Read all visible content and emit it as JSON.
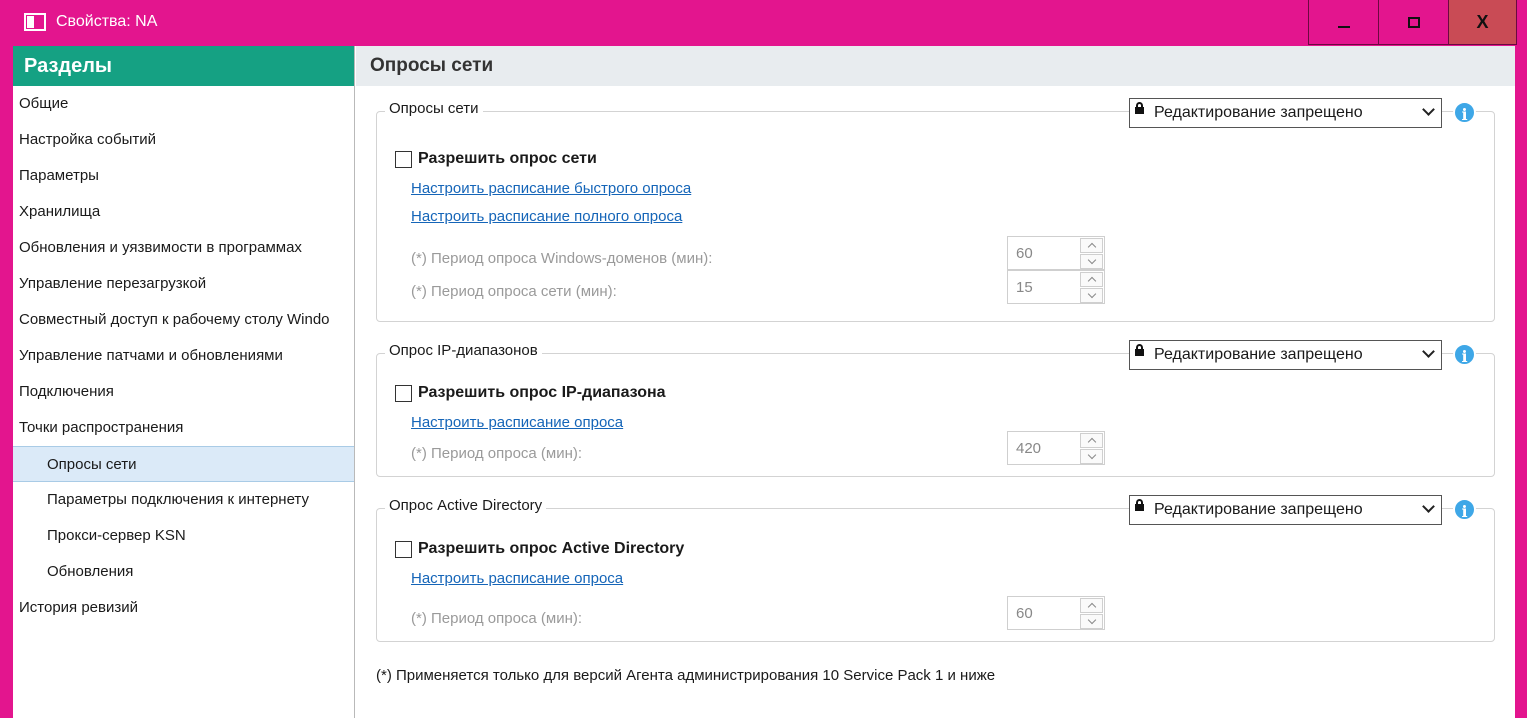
{
  "window": {
    "title": "Свойства: NA",
    "minimize_icon": "minimize-icon",
    "maximize_icon": "maximize-icon",
    "close_label": "X"
  },
  "sidebar": {
    "header": "Разделы",
    "items": [
      {
        "label": "Общие",
        "level": 0
      },
      {
        "label": "Настройка событий",
        "level": 0
      },
      {
        "label": "Параметры",
        "level": 0
      },
      {
        "label": "Хранилища",
        "level": 0
      },
      {
        "label": "Обновления и уязвимости в программах",
        "level": 0
      },
      {
        "label": "Управление перезагрузкой",
        "level": 0
      },
      {
        "label": "Совместный доступ к рабочему столу Windo",
        "level": 0
      },
      {
        "label": "Управление патчами и обновлениями",
        "level": 0
      },
      {
        "label": "Подключения",
        "level": 0
      },
      {
        "label": "Точки распространения",
        "level": 0
      },
      {
        "label": "Опросы сети",
        "level": 1,
        "selected": true
      },
      {
        "label": "Параметры подключения к интернету",
        "level": 1
      },
      {
        "label": "Прокси-сервер KSN",
        "level": 1
      },
      {
        "label": "Обновления",
        "level": 1
      },
      {
        "label": "История ревизий",
        "level": 0
      }
    ]
  },
  "main": {
    "title": "Опросы сети",
    "groups": [
      {
        "title": "Опросы сети",
        "lock_select": "Редактирование запрещено",
        "checkbox_label": "Разрешить опрос сети",
        "checked": false,
        "links": [
          "Настроить расписание быстрого опроса",
          "Настроить расписание полного опроса"
        ],
        "fields": [
          {
            "label": "(*) Период опроса Windows-доменов (мин):",
            "value": "60"
          },
          {
            "label": "(*) Период опроса сети (мин):",
            "value": "15"
          }
        ]
      },
      {
        "title": "Опрос IP-диапазонов",
        "lock_select": "Редактирование запрещено",
        "checkbox_label": "Разрешить опрос IP-диапазона",
        "checked": false,
        "links": [
          "Настроить расписание опроса"
        ],
        "fields": [
          {
            "label": "(*) Период опроса (мин):",
            "value": "420"
          }
        ]
      },
      {
        "title": "Опрос Active Directory",
        "lock_select": "Редактирование запрещено",
        "checkbox_label": "Разрешить опрос Active Directory",
        "checked": false,
        "links": [
          "Настроить расписание опроса"
        ],
        "fields": [
          {
            "label": "(*) Период опроса (мин):",
            "value": "60"
          }
        ]
      }
    ],
    "footnote": "(*) Применяется только для версий Агента администрирования 10 Service Pack 1 и ниже"
  },
  "colors": {
    "window_frame": "#e3158e",
    "sidebar_header": "#15a183",
    "link": "#1565b8",
    "selected_item": "#dbeaf8",
    "close_button": "#c94b55",
    "info_icon": "#3ea7e7"
  }
}
